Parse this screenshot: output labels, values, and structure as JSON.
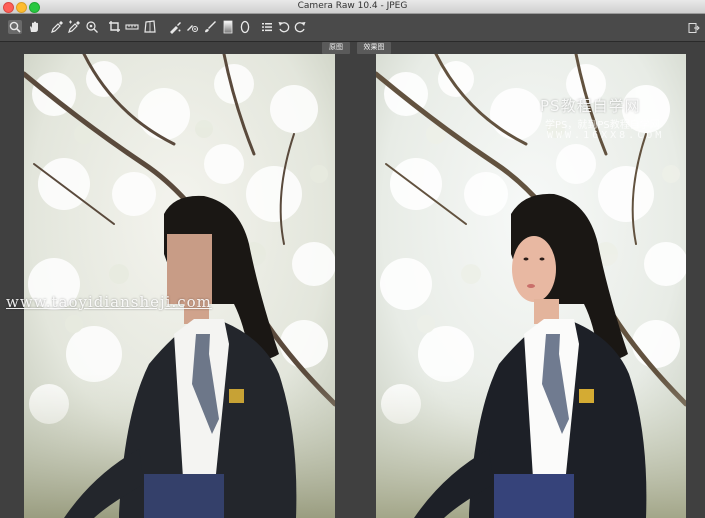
{
  "window": {
    "title": "Camera Raw 10.4 -  JPEG"
  },
  "toolbar": {
    "tools": [
      {
        "name": "zoom-tool",
        "icon": "magnifier-icon"
      },
      {
        "name": "hand-tool",
        "icon": "hand-icon"
      },
      {
        "name": "white-balance-tool",
        "icon": "eyedropper-icon"
      },
      {
        "name": "color-sampler-tool",
        "icon": "eyedropper-plus-icon"
      },
      {
        "name": "targeted-adjustment-tool",
        "icon": "target-icon"
      },
      {
        "name": "crop-tool",
        "icon": "crop-icon"
      },
      {
        "name": "straighten-tool",
        "icon": "ruler-icon"
      },
      {
        "name": "transform-tool",
        "icon": "transform-icon"
      },
      {
        "name": "spot-removal-tool",
        "icon": "brush-heal-icon"
      },
      {
        "name": "red-eye-tool",
        "icon": "red-eye-icon"
      },
      {
        "name": "adjustment-brush-tool",
        "icon": "brush-icon"
      },
      {
        "name": "graduated-filter-tool",
        "icon": "gradient-icon"
      },
      {
        "name": "radial-filter-tool",
        "icon": "ellipse-icon"
      },
      {
        "name": "preferences-button",
        "icon": "list-icon"
      },
      {
        "name": "rotate-left-button",
        "icon": "rotate-ccw-icon"
      },
      {
        "name": "rotate-right-button",
        "icon": "rotate-cw-icon"
      }
    ]
  },
  "view": {
    "before_label": "原图",
    "after_label": "效果图"
  },
  "watermarks": {
    "brand": "PS教程自学网",
    "tagline": "学PS，就到PS教程自学网",
    "url": "WWW.16XX8.COM",
    "site": "www.taoyidiansheji.com"
  },
  "colors": {
    "toolbar_bg": "#4a4a4a",
    "canvas_bg": "#404040",
    "close": "#ff5f57",
    "minimize": "#febc2e",
    "maximize": "#28c840"
  }
}
